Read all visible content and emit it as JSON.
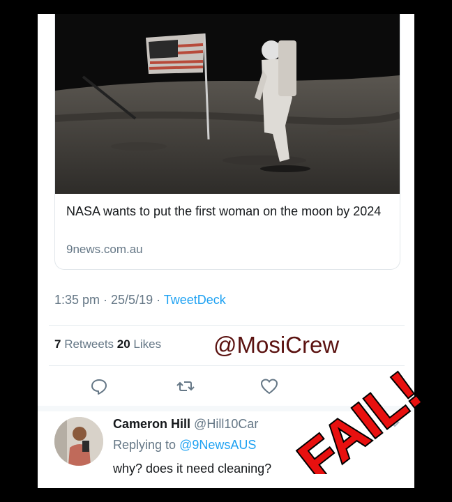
{
  "card": {
    "title": "NASA wants to put the first woman on the moon by 2024",
    "domain": "9news.com.au"
  },
  "tweet_meta": {
    "time_date": "1:35 pm · 25/5/19 · ",
    "source": "TweetDeck"
  },
  "stats": {
    "retweets_count": "7",
    "retweets_label": " Retweets ",
    "likes_count": "20",
    "likes_label": " Likes"
  },
  "watermark": "@MosiCrew",
  "actions": [
    "reply-icon",
    "retweet-icon",
    "like-icon"
  ],
  "reply": {
    "name": "Cameron Hill",
    "handle": "@Hill10Car",
    "replying_prefix": "Replying to ",
    "replying_mention": "@9NewsAUS",
    "text": "why? does it need cleaning?"
  },
  "overlay": {
    "text": "FAIL!",
    "fill": "#e8100f",
    "stroke": "#000000"
  },
  "colors": {
    "link": "#1da1f2",
    "muted": "#657786",
    "text": "#14171a"
  }
}
